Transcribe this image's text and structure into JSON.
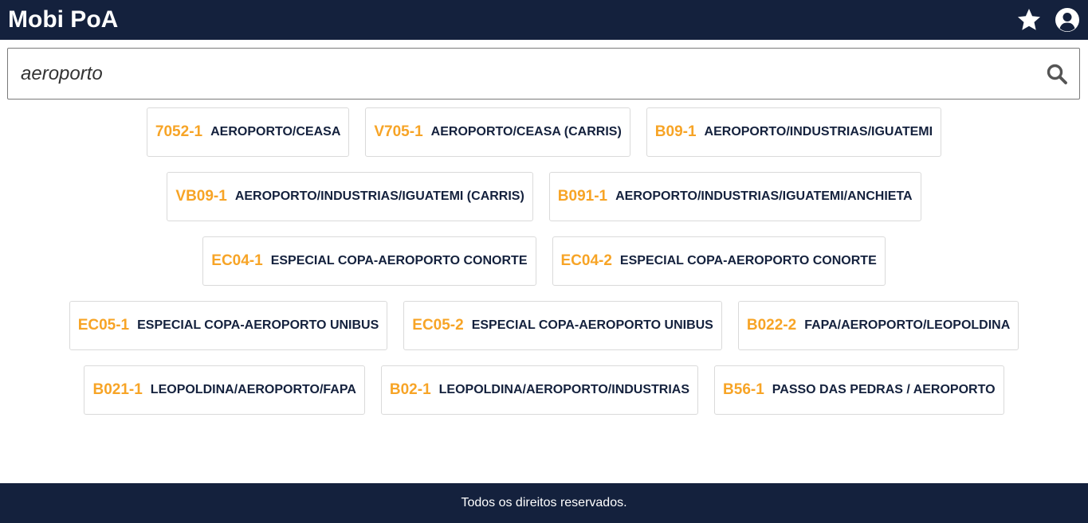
{
  "header": {
    "title": "Mobi PoA",
    "favorites_icon": "star-icon",
    "profile_icon": "user-circle-icon"
  },
  "search": {
    "value": "aeroporto",
    "icon": "search-icon"
  },
  "results": [
    [
      {
        "code": "7052-1",
        "name": "AEROPORTO/CEASA"
      },
      {
        "code": "V705-1",
        "name": "AEROPORTO/CEASA (CARRIS)"
      },
      {
        "code": "B09-1",
        "name": "AEROPORTO/INDUSTRIAS/IGUATEMI"
      }
    ],
    [
      {
        "code": "VB09-1",
        "name": "AEROPORTO/INDUSTRIAS/IGUATEMI (CARRIS)"
      },
      {
        "code": "B091-1",
        "name": "AEROPORTO/INDUSTRIAS/IGUATEMI/ANCHIETA"
      }
    ],
    [
      {
        "code": "EC04-1",
        "name": "ESPECIAL COPA-AEROPORTO CONORTE"
      },
      {
        "code": "EC04-2",
        "name": "ESPECIAL COPA-AEROPORTO CONORTE"
      }
    ],
    [
      {
        "code": "EC05-1",
        "name": "ESPECIAL COPA-AEROPORTO UNIBUS"
      },
      {
        "code": "EC05-2",
        "name": "ESPECIAL COPA-AEROPORTO UNIBUS"
      },
      {
        "code": "B022-2",
        "name": "FAPA/AEROPORTO/LEOPOLDINA"
      }
    ],
    [
      {
        "code": "B021-1",
        "name": "LEOPOLDINA/AEROPORTO/FAPA"
      },
      {
        "code": "B02-1",
        "name": "LEOPOLDINA/AEROPORTO/INDUSTRIAS"
      },
      {
        "code": "B56-1",
        "name": "PASSO DAS PEDRAS / AEROPORTO"
      }
    ]
  ],
  "footer": {
    "text": "Todos os direitos reservados."
  },
  "colors": {
    "navy": "#14213d",
    "accent_orange": "#f7a426"
  }
}
